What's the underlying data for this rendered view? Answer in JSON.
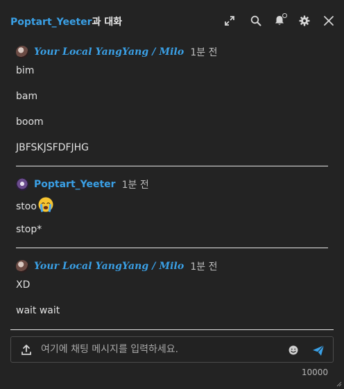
{
  "header": {
    "partner": "Poptart_Yeeter",
    "suffix": "과 대화"
  },
  "messages": {
    "group1": {
      "username": "Your Local YangYang / Milo",
      "time": "1분 전",
      "lines": [
        "bim",
        "bam",
        "boom",
        "JBFSKJSFDFJHG"
      ]
    },
    "group2": {
      "username": "Poptart_Yeeter",
      "time": "1분 전",
      "lines": [
        "stoo",
        "stop*"
      ]
    },
    "group3": {
      "username": "Your Local YangYang / Milo",
      "time": "1분 전",
      "lines": [
        "XD",
        "wait wait"
      ]
    }
  },
  "composer": {
    "placeholder": "여기에 채팅 메시지를 입력하세요.",
    "char_limit": "10000"
  },
  "icons": {
    "expand": "expand-icon",
    "search": "search-icon",
    "bell": "bell-icon",
    "gear": "gear-icon",
    "close": "close-icon",
    "upload": "upload-icon",
    "emoji": "smiley-icon",
    "send": "send-icon"
  },
  "colors": {
    "background": "#232323",
    "accent": "#3aa0e6",
    "text": "#e2e2e2",
    "muted": "#bdbdbd"
  }
}
